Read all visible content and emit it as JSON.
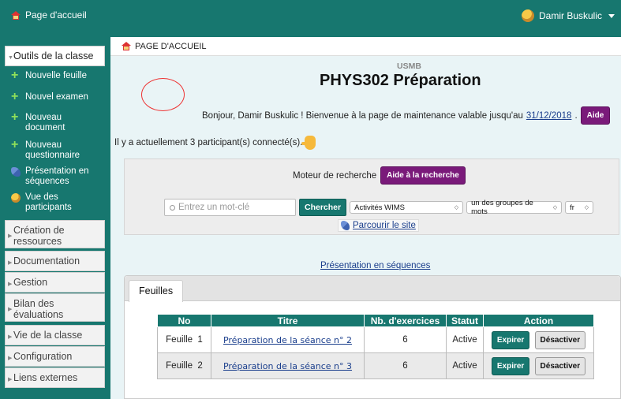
{
  "topbar": {
    "home_label": "Page d'accueil",
    "user_name": "Damir Buskulic"
  },
  "sidebar": {
    "open_section": "Outils de la classe",
    "sub_items": [
      {
        "label": "Nouvelle feuille",
        "icon": "plus-icon"
      },
      {
        "label": "Nouvel examen",
        "icon": "plus-icon"
      },
      {
        "label": "Nouveau document",
        "icon": "plus-icon"
      },
      {
        "label": "Nouveau questionnaire",
        "icon": "plus-icon"
      },
      {
        "label": "Présentation en séquences",
        "icon": "presentation-icon"
      },
      {
        "label": "Vue des participants",
        "icon": "participants-icon"
      }
    ],
    "sections": [
      "Création de ressources",
      "Documentation",
      "Gestion",
      "Bilan des évaluations",
      "Vie de la classe",
      "Configuration",
      "Liens externes"
    ]
  },
  "breadcrumb": "PAGE D'ACCUEIL",
  "course": {
    "org": "USMB",
    "title": "PHYS302 Préparation"
  },
  "welcome": {
    "text": "Bonjour, Damir Buskulic ! Bienvenue à la page de maintenance valable jusqu'au",
    "date": "31/12/2018",
    "sep": ".",
    "help_button": "Aide"
  },
  "connected": "Il y a actuellement 3 participant(s) connecté(s).",
  "search": {
    "title": "Moteur de recherche",
    "help_button": "Aide à la recherche",
    "placeholder": "Entrez un mot-clé",
    "search_button": "Chercher",
    "scope_select": "Activités WIMS",
    "mode_select": "un des groupes de mots",
    "lang_select": "fr",
    "browse_link": "Parcourir le site"
  },
  "sequences_link": "Présentation en séquences",
  "tabs": {
    "active": "Feuilles"
  },
  "table": {
    "headers": [
      "No",
      "Titre",
      "Nb. d'exercices",
      "Statut",
      "Action"
    ],
    "rows": [
      {
        "no": "Feuille  1",
        "title": "Préparation de la séance n° 2",
        "count": "6",
        "status": "Active",
        "expire": "Expirer",
        "deactivate": "Désactiver"
      },
      {
        "no": "Feuille  2",
        "title": "Préparation de la séance n° 3",
        "count": "6",
        "status": "Active",
        "expire": "Expirer",
        "deactivate": "Désactiver"
      }
    ]
  },
  "colors": {
    "teal": "#17776f",
    "purple": "#7a1a7a",
    "link": "#1a3e8c"
  }
}
